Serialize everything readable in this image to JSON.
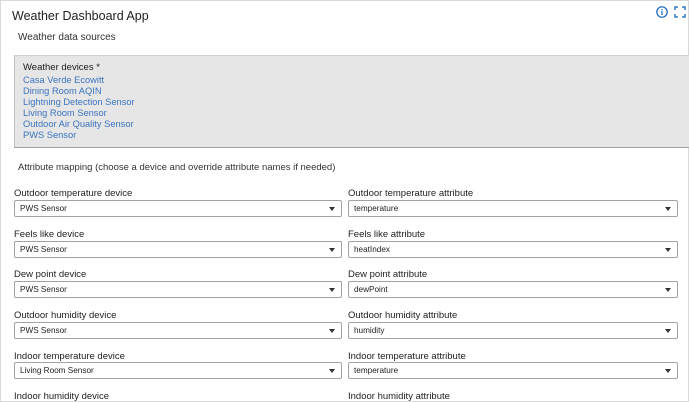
{
  "app": {
    "title": "Weather Dashboard App"
  },
  "header_icons": {
    "info": "info-circle-icon",
    "fullscreen": "fullscreen-icon",
    "accent": "#1565c0"
  },
  "sources": {
    "title": "Weather data sources",
    "devices_label": "Weather devices *",
    "devices": [
      "Casa Verde Ecowitt",
      "Dining Room AQIN",
      "Lightning Detection Sensor",
      "Living Room Sensor",
      "Outdoor Air Quality Sensor",
      "PWS Sensor"
    ],
    "link_color": "#3b74c0"
  },
  "mapping": {
    "title": "Attribute mapping (choose a device and override attribute names if needed)",
    "rows": [
      {
        "device_label": "Outdoor temperature device",
        "device_value": "PWS Sensor",
        "attr_label": "Outdoor temperature attribute",
        "attr_value": "temperature"
      },
      {
        "device_label": "Feels like device",
        "device_value": "PWS Sensor",
        "attr_label": "Feels like attribute",
        "attr_value": "heatIndex"
      },
      {
        "device_label": "Dew point device",
        "device_value": "PWS Sensor",
        "attr_label": "Dew point attribute",
        "attr_value": "dewPoint"
      },
      {
        "device_label": "Outdoor humidity device",
        "device_value": "PWS Sensor",
        "attr_label": "Outdoor humidity attribute",
        "attr_value": "humidity"
      },
      {
        "device_label": "Indoor temperature device",
        "device_value": "Living Room Sensor",
        "attr_label": "Indoor temperature attribute",
        "attr_value": "temperature"
      },
      {
        "device_label": "Indoor humidity device",
        "device_value": "",
        "attr_label": "Indoor humidity attribute",
        "attr_value": ""
      }
    ]
  }
}
